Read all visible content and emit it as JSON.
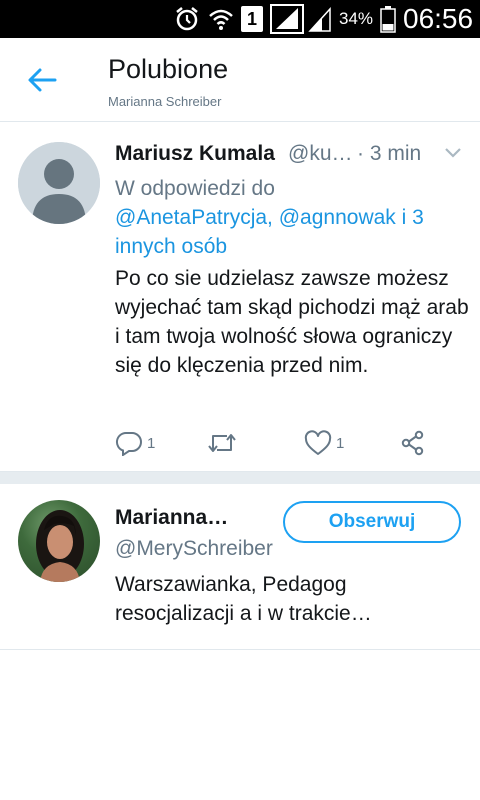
{
  "status_bar": {
    "battery_percent": "34%",
    "time": "06:56",
    "sim_slot": "1",
    "icons": [
      "alarm-icon",
      "wifi-icon",
      "sim-icon",
      "signal-icon",
      "signal-icon",
      "battery-icon"
    ]
  },
  "header": {
    "title": "Polubione",
    "subtitle": "Marianna Schreiber",
    "back_icon": "arrow-left-icon"
  },
  "tweet": {
    "author_name": "Mariusz Kumala",
    "author_handle": "@ku…",
    "time": "· 3 min",
    "reply_prefix": "W odpowiedzi do",
    "reply_mentions": "@AnetaPatrycja, @agnnowak i 3 innych osób",
    "text": "Po co sie udzielasz zawsze możesz wyjechać tam skąd pichodzi mąż arab i tam twoja wolność słowa ograniczy się do klęczenia przed nim.",
    "actions": {
      "reply_count": "1",
      "retweet_count": "",
      "like_count": "1"
    }
  },
  "user_card": {
    "name": "Marianna…",
    "handle": "@MerySchreiber",
    "follow_label": "Obserwuj",
    "bio": "Warszawianka, Pedagog resocjalizacji a i w trakcie…"
  },
  "colors": {
    "accent": "#1da1f2",
    "link": "#1b95e0",
    "secondary_text": "#657786",
    "primary_text": "#14171a",
    "divider": "#e1e8ed"
  }
}
